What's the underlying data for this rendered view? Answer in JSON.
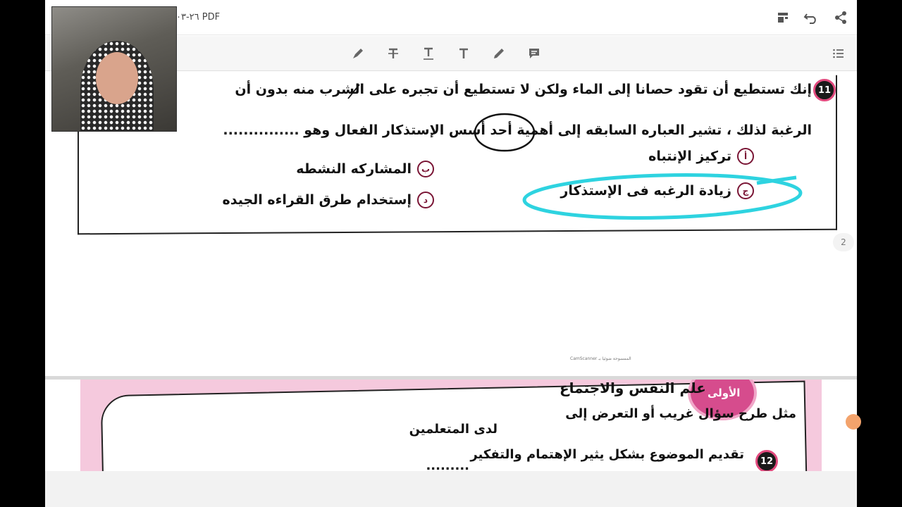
{
  "topbar": {
    "title": "٢٦-٠٣ PDF",
    "icons": [
      "layout-icon",
      "undo-icon",
      "share-icon"
    ]
  },
  "toolbar": {
    "tools": [
      {
        "name": "highlighter-tool",
        "glyph": "✎"
      },
      {
        "name": "strikethrough-tool",
        "glyph": "T"
      },
      {
        "name": "underline-tool",
        "glyph": "T"
      },
      {
        "name": "text-tool",
        "glyph": "T"
      },
      {
        "name": "pen-tool",
        "glyph": "✎"
      },
      {
        "name": "comment-tool",
        "glyph": "▤"
      }
    ],
    "list_icon": "list-icon"
  },
  "question11": {
    "number": "11",
    "line1": "إنك تستطيع أن تقود حصانا إلى الماء ولكن لا تستطيع أن تجبره على الشرب منه بدون أن",
    "line2": "الرغبة لذلك ، تشير العباره السابقه إلى أهمية أحد أسس الإستذكار الفعال وهو ...............",
    "options": [
      {
        "marker": "أ",
        "text": "تركيز الإنتباه"
      },
      {
        "marker": "ب",
        "text": "المشاركه النشطه"
      },
      {
        "marker": "ج",
        "text": "زيادة الرغبه فى الإستذكار"
      },
      {
        "marker": "د",
        "text": "إستخدام طرق القراءه الجيده"
      }
    ]
  },
  "page_number": "2",
  "scanner_text": "CamScanner الممسوحة ضوئيا بـ",
  "page2": {
    "badge": "الأولى",
    "title": "علم النفس والاجتماع",
    "line1": "مثل طرح سؤال غريب أو التعرض إلى",
    "line1b": "لدى المتعلمين",
    "line2": "تقديم الموضوع بشكل يثير الإهتمام والتفكير",
    "dots": ".........",
    "number": "12"
  },
  "colors": {
    "annotation_cyan": "#2ed3e0",
    "pink_border": "#f5c9dd",
    "badge_pink": "#d64c8d"
  }
}
